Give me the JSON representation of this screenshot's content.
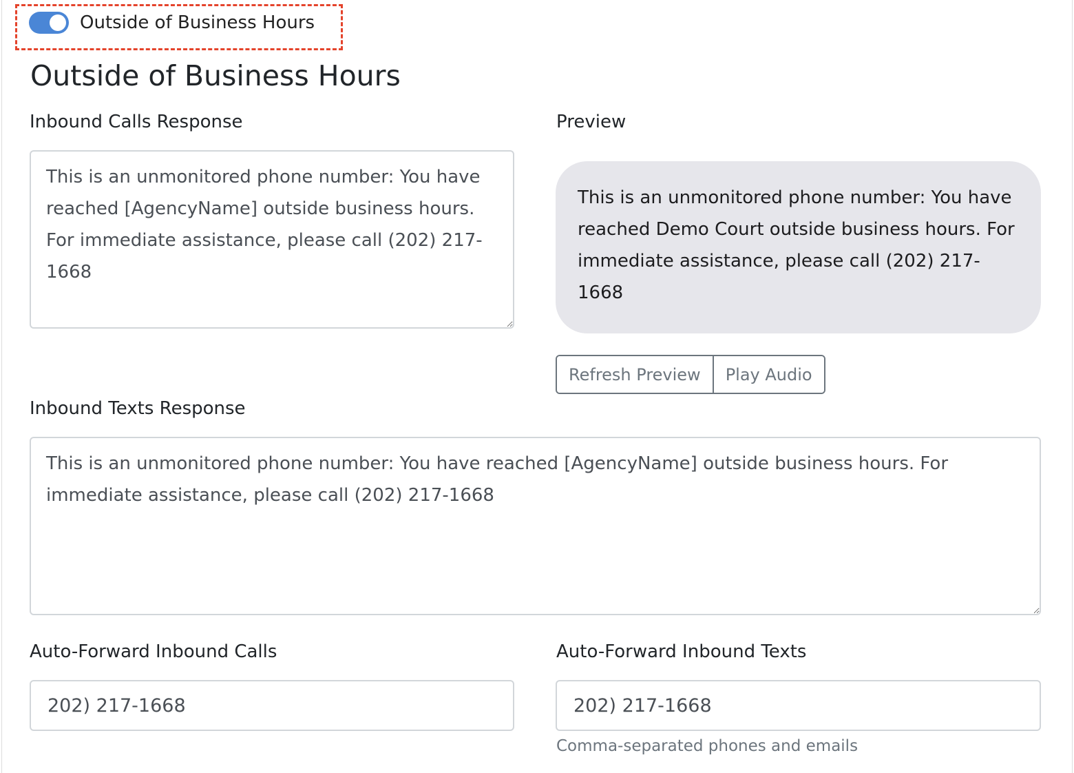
{
  "toggle": {
    "label": "Outside of Business Hours",
    "enabled": true,
    "accent": "#4a86d6"
  },
  "highlight_color": "#e4432b",
  "section_title": "Outside of Business Hours",
  "inbound_calls": {
    "label": "Inbound Calls Response",
    "value": "This is an unmonitored phone number: You have reached [AgencyName] outside business hours. For immediate assistance, please call (202) 217-1668"
  },
  "preview": {
    "label": "Preview",
    "text": "This is an unmonitored phone number: You have reached Demo Court outside business hours. For immediate assistance, please call (202) 217-1668",
    "refresh_label": "Refresh Preview",
    "play_label": "Play Audio"
  },
  "inbound_texts": {
    "label": "Inbound Texts Response",
    "value": "This is an unmonitored phone number: You have reached [AgencyName] outside business hours. For immediate assistance, please call (202) 217-1668"
  },
  "auto_forward_calls": {
    "label": "Auto-Forward Inbound Calls",
    "value": "202) 217-1668"
  },
  "auto_forward_texts": {
    "label": "Auto-Forward Inbound Texts",
    "value": "202) 217-1668",
    "help": "Comma-separated phones and emails"
  }
}
